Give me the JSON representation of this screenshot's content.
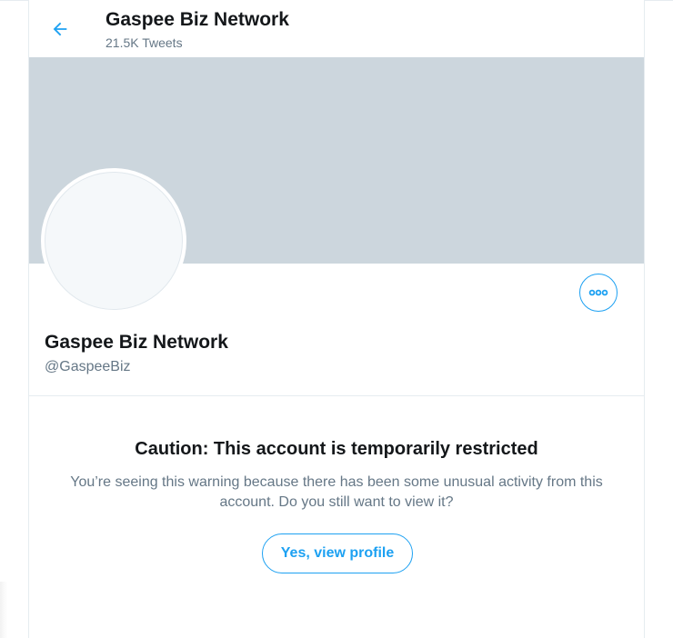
{
  "header": {
    "title": "Gaspee Biz Network",
    "subtitle": "21.5K Tweets",
    "back_icon": "arrow-left-icon"
  },
  "profile": {
    "name": "Gaspee Biz Network",
    "handle": "@GaspeeBiz",
    "more_icon": "more-horizontal-icon"
  },
  "caution": {
    "title": "Caution: This account is temporarily restricted",
    "body": "You’re seeing this warning because there has been some unusual activity from this account. Do you still want to view it?",
    "button_label": "Yes, view profile"
  },
  "colors": {
    "accent": "#1da1f2",
    "banner": "#ccd6dd",
    "text_primary": "#14171a",
    "text_secondary": "#657786",
    "border": "#e6ecf0"
  }
}
